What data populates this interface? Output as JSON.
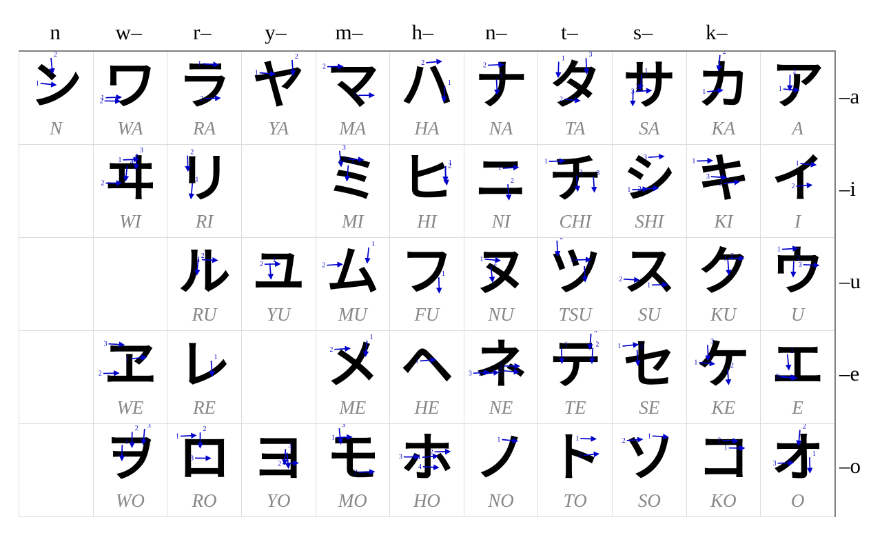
{
  "title": "Katakana Stroke Order Chart",
  "colors": {
    "glyph": "#000000",
    "stroke_arrow": "#0000cc",
    "romaji": "#878787",
    "grid_line": "#dcdcdc",
    "outer_border": "#808080",
    "background": "#ffffff"
  },
  "column_headers": [
    {
      "label": "n"
    },
    {
      "label": "w–"
    },
    {
      "label": "r–"
    },
    {
      "label": "y–"
    },
    {
      "label": "m–"
    },
    {
      "label": "h–"
    },
    {
      "label": "n–"
    },
    {
      "label": "t–"
    },
    {
      "label": "s–"
    },
    {
      "label": "k–"
    },
    {
      "label": ""
    }
  ],
  "row_labels": [
    {
      "label": "–a"
    },
    {
      "label": "–i"
    },
    {
      "label": "–u"
    },
    {
      "label": "–e"
    },
    {
      "label": "–o"
    }
  ],
  "rows": [
    {
      "vowel": "a",
      "cells": [
        {
          "kana": "ン",
          "romaji": "N",
          "strokes": 2,
          "empty": false
        },
        {
          "kana": "ワ",
          "romaji": "WA",
          "strokes": 2,
          "empty": false
        },
        {
          "kana": "ラ",
          "romaji": "RA",
          "strokes": 2,
          "empty": false
        },
        {
          "kana": "ヤ",
          "romaji": "YA",
          "strokes": 2,
          "empty": false
        },
        {
          "kana": "マ",
          "romaji": "MA",
          "strokes": 2,
          "empty": false
        },
        {
          "kana": "ハ",
          "romaji": "HA",
          "strokes": 2,
          "empty": false
        },
        {
          "kana": "ナ",
          "romaji": "NA",
          "strokes": 2,
          "empty": false
        },
        {
          "kana": "タ",
          "romaji": "TA",
          "strokes": 3,
          "empty": false
        },
        {
          "kana": "サ",
          "romaji": "SA",
          "strokes": 3,
          "empty": false
        },
        {
          "kana": "カ",
          "romaji": "KA",
          "strokes": 2,
          "empty": false
        },
        {
          "kana": "ア",
          "romaji": "A",
          "strokes": 2,
          "empty": false
        }
      ]
    },
    {
      "vowel": "i",
      "cells": [
        {
          "kana": "",
          "romaji": "",
          "strokes": 0,
          "empty": true
        },
        {
          "kana": "ヰ",
          "romaji": "WI",
          "strokes": 4,
          "empty": false
        },
        {
          "kana": "リ",
          "romaji": "RI",
          "strokes": 2,
          "empty": false
        },
        {
          "kana": "",
          "romaji": "",
          "strokes": 0,
          "empty": true
        },
        {
          "kana": "ミ",
          "romaji": "MI",
          "strokes": 3,
          "empty": false
        },
        {
          "kana": "ヒ",
          "romaji": "HI",
          "strokes": 2,
          "empty": false
        },
        {
          "kana": "ニ",
          "romaji": "NI",
          "strokes": 2,
          "empty": false
        },
        {
          "kana": "チ",
          "romaji": "CHI",
          "strokes": 3,
          "empty": false
        },
        {
          "kana": "シ",
          "romaji": "SHI",
          "strokes": 3,
          "empty": false
        },
        {
          "kana": "キ",
          "romaji": "KI",
          "strokes": 3,
          "empty": false
        },
        {
          "kana": "イ",
          "romaji": "I",
          "strokes": 2,
          "empty": false
        }
      ]
    },
    {
      "vowel": "u",
      "cells": [
        {
          "kana": "",
          "romaji": "",
          "strokes": 0,
          "empty": true
        },
        {
          "kana": "",
          "romaji": "",
          "strokes": 0,
          "empty": true
        },
        {
          "kana": "ル",
          "romaji": "RU",
          "strokes": 2,
          "empty": false
        },
        {
          "kana": "ユ",
          "romaji": "YU",
          "strokes": 2,
          "empty": false
        },
        {
          "kana": "ム",
          "romaji": "MU",
          "strokes": 2,
          "empty": false
        },
        {
          "kana": "フ",
          "romaji": "FU",
          "strokes": 1,
          "empty": false
        },
        {
          "kana": "ヌ",
          "romaji": "NU",
          "strokes": 2,
          "empty": false
        },
        {
          "kana": "ツ",
          "romaji": "TSU",
          "strokes": 3,
          "empty": false
        },
        {
          "kana": "ス",
          "romaji": "SU",
          "strokes": 2,
          "empty": false
        },
        {
          "kana": "ク",
          "romaji": "KU",
          "strokes": 2,
          "empty": false
        },
        {
          "kana": "ウ",
          "romaji": "U",
          "strokes": 3,
          "empty": false
        }
      ]
    },
    {
      "vowel": "e",
      "cells": [
        {
          "kana": "",
          "romaji": "",
          "strokes": 0,
          "empty": true
        },
        {
          "kana": "ヱ",
          "romaji": "WE",
          "strokes": 3,
          "empty": false
        },
        {
          "kana": "レ",
          "romaji": "RE",
          "strokes": 1,
          "empty": false
        },
        {
          "kana": "",
          "romaji": "",
          "strokes": 0,
          "empty": true
        },
        {
          "kana": "メ",
          "romaji": "ME",
          "strokes": 2,
          "empty": false
        },
        {
          "kana": "ヘ",
          "romaji": "HE",
          "strokes": 1,
          "empty": false
        },
        {
          "kana": "ネ",
          "romaji": "NE",
          "strokes": 4,
          "empty": false
        },
        {
          "kana": "テ",
          "romaji": "TE",
          "strokes": 3,
          "empty": false
        },
        {
          "kana": "セ",
          "romaji": "SE",
          "strokes": 2,
          "empty": false
        },
        {
          "kana": "ケ",
          "romaji": "KE",
          "strokes": 3,
          "empty": false
        },
        {
          "kana": "エ",
          "romaji": "E",
          "strokes": 3,
          "empty": false
        }
      ]
    },
    {
      "vowel": "o",
      "cells": [
        {
          "kana": "",
          "romaji": "",
          "strokes": 0,
          "empty": true
        },
        {
          "kana": "ヲ",
          "romaji": "WO",
          "strokes": 3,
          "empty": false
        },
        {
          "kana": "ロ",
          "romaji": "RO",
          "strokes": 3,
          "empty": false
        },
        {
          "kana": "ヨ",
          "romaji": "YO",
          "strokes": 3,
          "empty": false
        },
        {
          "kana": "モ",
          "romaji": "MO",
          "strokes": 3,
          "empty": false
        },
        {
          "kana": "ホ",
          "romaji": "HO",
          "strokes": 4,
          "empty": false
        },
        {
          "kana": "ノ",
          "romaji": "NO",
          "strokes": 1,
          "empty": false
        },
        {
          "kana": "ト",
          "romaji": "TO",
          "strokes": 2,
          "empty": false
        },
        {
          "kana": "ソ",
          "romaji": "SO",
          "strokes": 2,
          "empty": false
        },
        {
          "kana": "コ",
          "romaji": "KO",
          "strokes": 2,
          "empty": false
        },
        {
          "kana": "オ",
          "romaji": "O",
          "strokes": 3,
          "empty": false
        }
      ]
    }
  ]
}
